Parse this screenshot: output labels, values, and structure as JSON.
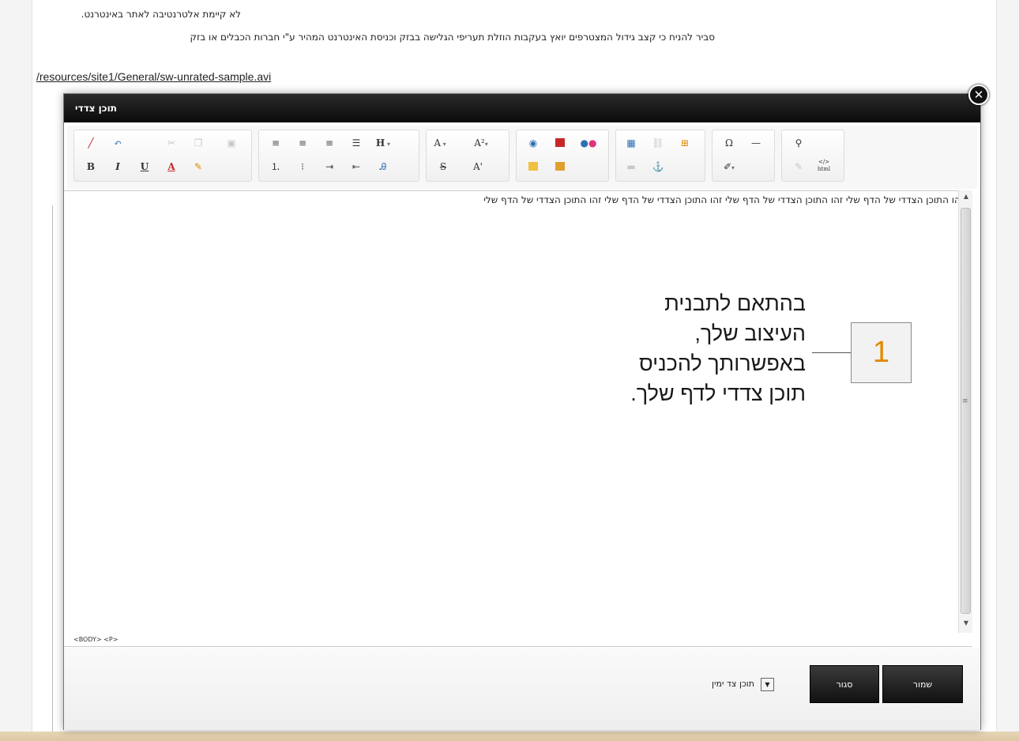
{
  "background": {
    "line1": "לא קיימת אלטרנטיבה לאתר באינטרנט.",
    "line2": "סביר להניח כי קצב גידול המצטרפים יואץ בעקבות הוזלת תעריפי הגלישה בבזק וכניסת האינטרנט המהיר ע\"י חברות הכבלים או בזק",
    "link": "/resources/site1/General/sw-unrated-sample.avi"
  },
  "dialog": {
    "title": "תוכן צדדי",
    "close_glyph": "✕",
    "editor_text": "זהו התוכן הצדדי של הדף שלי זהו התוכן הצדדי של הדף שלי זהו התוכן הצדדי של הדף שלי זהו התוכן הצדדי של הדף שלי",
    "status_path": "<BODY> <P>",
    "select_value": "תוכן צד ימין",
    "save_label": "שמור",
    "close_label": "סגור"
  },
  "toolbar": {
    "bold": "B",
    "italic": "I",
    "underline": "U",
    "font_color": "A",
    "heading": "H",
    "font_size": "A",
    "superscript_size": "A²",
    "strike": "S",
    "superscript": "A'",
    "special_char": "Ω",
    "source_label": "</> html"
  },
  "callout": {
    "text": "בהתאם לתבנית העיצוב שלך, באפשרותך להכניס תוכן צדדי לדף שלך.",
    "number": "1"
  },
  "colors": {
    "titlebar": "#111111",
    "callout_number": "#e08a00",
    "button": "#222222"
  }
}
